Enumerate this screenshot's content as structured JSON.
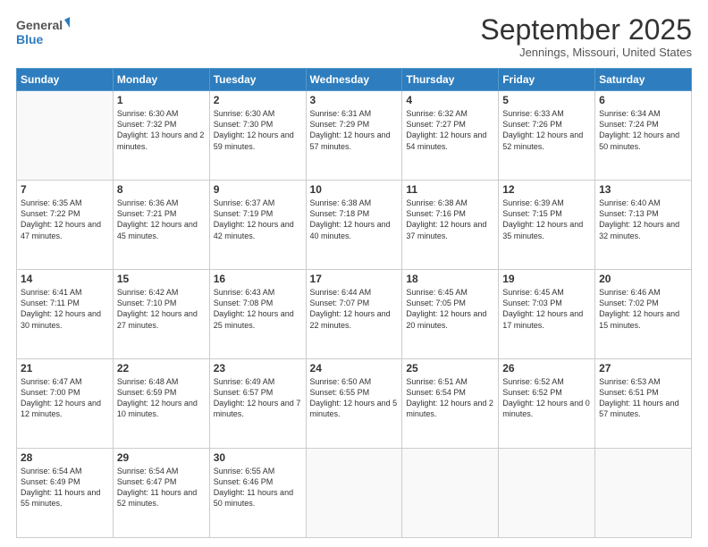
{
  "header": {
    "logo_line1": "General",
    "logo_line2": "Blue",
    "month": "September 2025",
    "location": "Jennings, Missouri, United States"
  },
  "days_of_week": [
    "Sunday",
    "Monday",
    "Tuesday",
    "Wednesday",
    "Thursday",
    "Friday",
    "Saturday"
  ],
  "weeks": [
    [
      {
        "day": "",
        "sunrise": "",
        "sunset": "",
        "daylight": ""
      },
      {
        "day": "1",
        "sunrise": "Sunrise: 6:30 AM",
        "sunset": "Sunset: 7:32 PM",
        "daylight": "Daylight: 13 hours and 2 minutes."
      },
      {
        "day": "2",
        "sunrise": "Sunrise: 6:30 AM",
        "sunset": "Sunset: 7:30 PM",
        "daylight": "Daylight: 12 hours and 59 minutes."
      },
      {
        "day": "3",
        "sunrise": "Sunrise: 6:31 AM",
        "sunset": "Sunset: 7:29 PM",
        "daylight": "Daylight: 12 hours and 57 minutes."
      },
      {
        "day": "4",
        "sunrise": "Sunrise: 6:32 AM",
        "sunset": "Sunset: 7:27 PM",
        "daylight": "Daylight: 12 hours and 54 minutes."
      },
      {
        "day": "5",
        "sunrise": "Sunrise: 6:33 AM",
        "sunset": "Sunset: 7:26 PM",
        "daylight": "Daylight: 12 hours and 52 minutes."
      },
      {
        "day": "6",
        "sunrise": "Sunrise: 6:34 AM",
        "sunset": "Sunset: 7:24 PM",
        "daylight": "Daylight: 12 hours and 50 minutes."
      }
    ],
    [
      {
        "day": "7",
        "sunrise": "Sunrise: 6:35 AM",
        "sunset": "Sunset: 7:22 PM",
        "daylight": "Daylight: 12 hours and 47 minutes."
      },
      {
        "day": "8",
        "sunrise": "Sunrise: 6:36 AM",
        "sunset": "Sunset: 7:21 PM",
        "daylight": "Daylight: 12 hours and 45 minutes."
      },
      {
        "day": "9",
        "sunrise": "Sunrise: 6:37 AM",
        "sunset": "Sunset: 7:19 PM",
        "daylight": "Daylight: 12 hours and 42 minutes."
      },
      {
        "day": "10",
        "sunrise": "Sunrise: 6:38 AM",
        "sunset": "Sunset: 7:18 PM",
        "daylight": "Daylight: 12 hours and 40 minutes."
      },
      {
        "day": "11",
        "sunrise": "Sunrise: 6:38 AM",
        "sunset": "Sunset: 7:16 PM",
        "daylight": "Daylight: 12 hours and 37 minutes."
      },
      {
        "day": "12",
        "sunrise": "Sunrise: 6:39 AM",
        "sunset": "Sunset: 7:15 PM",
        "daylight": "Daylight: 12 hours and 35 minutes."
      },
      {
        "day": "13",
        "sunrise": "Sunrise: 6:40 AM",
        "sunset": "Sunset: 7:13 PM",
        "daylight": "Daylight: 12 hours and 32 minutes."
      }
    ],
    [
      {
        "day": "14",
        "sunrise": "Sunrise: 6:41 AM",
        "sunset": "Sunset: 7:11 PM",
        "daylight": "Daylight: 12 hours and 30 minutes."
      },
      {
        "day": "15",
        "sunrise": "Sunrise: 6:42 AM",
        "sunset": "Sunset: 7:10 PM",
        "daylight": "Daylight: 12 hours and 27 minutes."
      },
      {
        "day": "16",
        "sunrise": "Sunrise: 6:43 AM",
        "sunset": "Sunset: 7:08 PM",
        "daylight": "Daylight: 12 hours and 25 minutes."
      },
      {
        "day": "17",
        "sunrise": "Sunrise: 6:44 AM",
        "sunset": "Sunset: 7:07 PM",
        "daylight": "Daylight: 12 hours and 22 minutes."
      },
      {
        "day": "18",
        "sunrise": "Sunrise: 6:45 AM",
        "sunset": "Sunset: 7:05 PM",
        "daylight": "Daylight: 12 hours and 20 minutes."
      },
      {
        "day": "19",
        "sunrise": "Sunrise: 6:45 AM",
        "sunset": "Sunset: 7:03 PM",
        "daylight": "Daylight: 12 hours and 17 minutes."
      },
      {
        "day": "20",
        "sunrise": "Sunrise: 6:46 AM",
        "sunset": "Sunset: 7:02 PM",
        "daylight": "Daylight: 12 hours and 15 minutes."
      }
    ],
    [
      {
        "day": "21",
        "sunrise": "Sunrise: 6:47 AM",
        "sunset": "Sunset: 7:00 PM",
        "daylight": "Daylight: 12 hours and 12 minutes."
      },
      {
        "day": "22",
        "sunrise": "Sunrise: 6:48 AM",
        "sunset": "Sunset: 6:59 PM",
        "daylight": "Daylight: 12 hours and 10 minutes."
      },
      {
        "day": "23",
        "sunrise": "Sunrise: 6:49 AM",
        "sunset": "Sunset: 6:57 PM",
        "daylight": "Daylight: 12 hours and 7 minutes."
      },
      {
        "day": "24",
        "sunrise": "Sunrise: 6:50 AM",
        "sunset": "Sunset: 6:55 PM",
        "daylight": "Daylight: 12 hours and 5 minutes."
      },
      {
        "day": "25",
        "sunrise": "Sunrise: 6:51 AM",
        "sunset": "Sunset: 6:54 PM",
        "daylight": "Daylight: 12 hours and 2 minutes."
      },
      {
        "day": "26",
        "sunrise": "Sunrise: 6:52 AM",
        "sunset": "Sunset: 6:52 PM",
        "daylight": "Daylight: 12 hours and 0 minutes."
      },
      {
        "day": "27",
        "sunrise": "Sunrise: 6:53 AM",
        "sunset": "Sunset: 6:51 PM",
        "daylight": "Daylight: 11 hours and 57 minutes."
      }
    ],
    [
      {
        "day": "28",
        "sunrise": "Sunrise: 6:54 AM",
        "sunset": "Sunset: 6:49 PM",
        "daylight": "Daylight: 11 hours and 55 minutes."
      },
      {
        "day": "29",
        "sunrise": "Sunrise: 6:54 AM",
        "sunset": "Sunset: 6:47 PM",
        "daylight": "Daylight: 11 hours and 52 minutes."
      },
      {
        "day": "30",
        "sunrise": "Sunrise: 6:55 AM",
        "sunset": "Sunset: 6:46 PM",
        "daylight": "Daylight: 11 hours and 50 minutes."
      },
      {
        "day": "",
        "sunrise": "",
        "sunset": "",
        "daylight": ""
      },
      {
        "day": "",
        "sunrise": "",
        "sunset": "",
        "daylight": ""
      },
      {
        "day": "",
        "sunrise": "",
        "sunset": "",
        "daylight": ""
      },
      {
        "day": "",
        "sunrise": "",
        "sunset": "",
        "daylight": ""
      }
    ]
  ]
}
